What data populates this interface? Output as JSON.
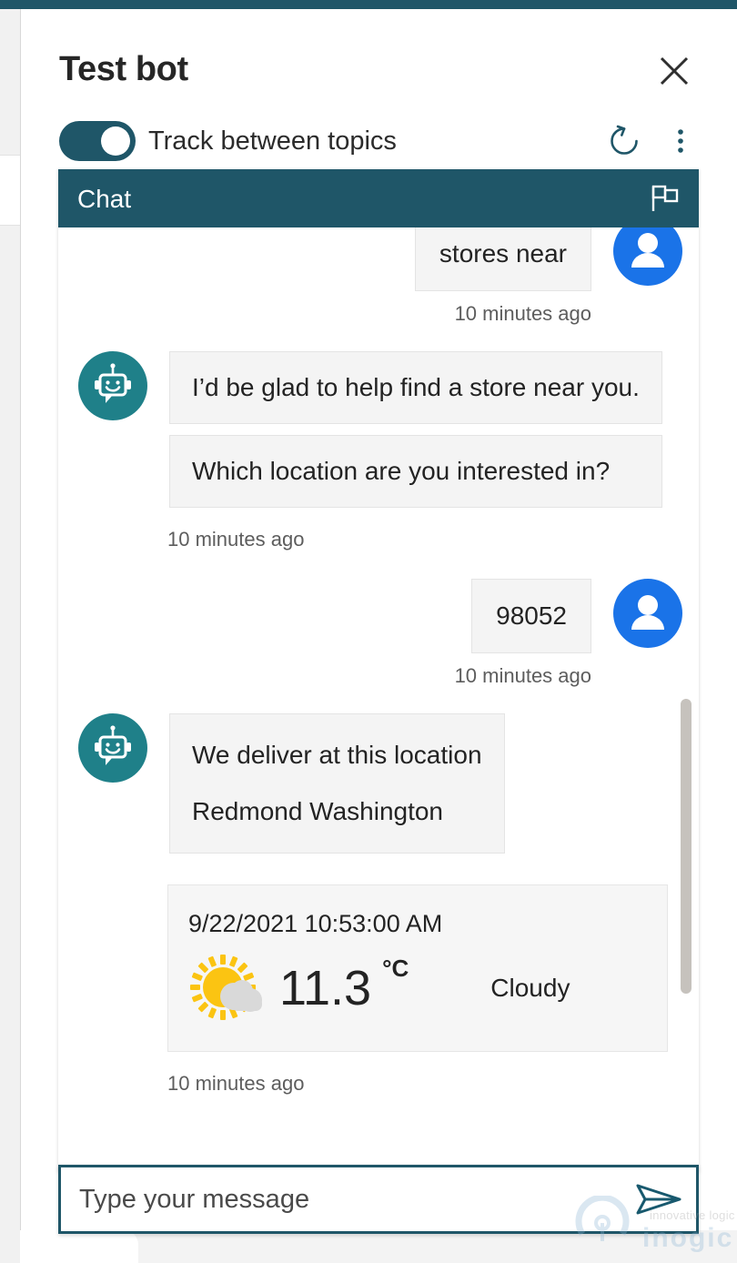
{
  "window": {
    "bot_title": "Test bot",
    "close_icon": "close-icon"
  },
  "header": {
    "toggle_label": "Track between topics",
    "toggle_on": true,
    "refresh_icon": "refresh-icon",
    "more_icon": "more-vertical-icon"
  },
  "chat": {
    "header_title": "Chat",
    "flag_icon": "flag-icon"
  },
  "messages": [
    {
      "role": "user",
      "text": "stores near",
      "timestamp": "10 minutes ago"
    },
    {
      "role": "bot",
      "lines": [
        "I’d be glad to help find a store near you.",
        "Which location are you interested in?"
      ],
      "timestamp": "10 minutes ago"
    },
    {
      "role": "user",
      "text": "98052",
      "timestamp": "10 minutes ago"
    },
    {
      "role": "bot",
      "lines": [
        "We deliver at this location",
        "Redmond Washington"
      ],
      "timestamp": "10 minutes ago"
    }
  ],
  "weather_card": {
    "datetime": "9/22/2021 10:53:00 AM",
    "temperature": "11.3",
    "unit": "°C",
    "condition": "Cloudy",
    "icon": "sun-behind-cloud-icon",
    "timestamp": "10 minutes ago"
  },
  "input": {
    "placeholder": "Type your message",
    "value": "",
    "send_icon": "send-icon"
  },
  "watermark": {
    "tagline": "innovative logic",
    "brand": "inogic"
  },
  "colors": {
    "teal": "#1f5668",
    "bot_avatar": "#1f8089",
    "user_avatar": "#1a73e8",
    "bubble_bg": "#f4f4f4",
    "sun_yellow": "#fbc412",
    "cloud_gray": "#d9d9d9"
  }
}
